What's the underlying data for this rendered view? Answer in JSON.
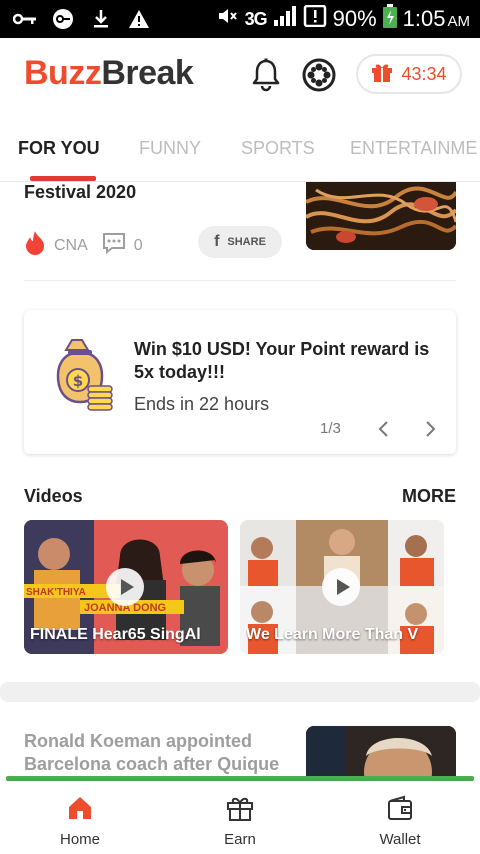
{
  "status_bar": {
    "battery": "90%",
    "time": "1:05",
    "ampm": "AM",
    "network": "3G"
  },
  "header": {
    "logo_part1": "Buzz",
    "logo_part2": "Break",
    "timer": "43:34",
    "accent_color": "#ee4d2d"
  },
  "tabs": [
    {
      "label": "FOR YOU",
      "active": true
    },
    {
      "label": "FUNNY"
    },
    {
      "label": "SPORTS"
    },
    {
      "label": "ENTERTAINME"
    }
  ],
  "article_top": {
    "title": "Festival 2020",
    "source": "CNA",
    "comments": "0",
    "share_label": "SHARE"
  },
  "promo": {
    "headline": "Win $10 USD! Your Point reward is 5x today!!!",
    "subtext": "Ends in 22 hours",
    "pager": "1/3"
  },
  "videos": {
    "label": "Videos",
    "more": "MORE",
    "items": [
      {
        "caption": "FINALE Hear65 SingAl",
        "overlay1": "SHAK'THIYA",
        "overlay2": "JOANNA DONG"
      },
      {
        "caption": "We Learn More Than V"
      }
    ]
  },
  "article_bottom": {
    "title": "Ronald Koeman appointed Barcelona coach after Quique"
  },
  "bottom_nav": [
    {
      "label": "Home",
      "icon": "home-icon",
      "active": true
    },
    {
      "label": "Earn",
      "icon": "gift-icon"
    },
    {
      "label": "Wallet",
      "icon": "wallet-icon"
    }
  ]
}
